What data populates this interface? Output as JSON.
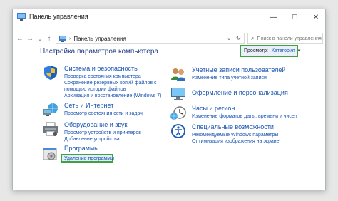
{
  "window": {
    "title": "Панель управления"
  },
  "controls": {
    "minimize": "—",
    "maximize": "☐",
    "close": "✕"
  },
  "nav": {
    "back": "←",
    "forward": "→",
    "down": "⌄",
    "up": "↑"
  },
  "address": {
    "path": "Панель управления",
    "separator": "›",
    "dropdown": "⌄",
    "refresh": "↻"
  },
  "search": {
    "placeholder": "Поиск в панели управления",
    "icon": "search-icon"
  },
  "main": {
    "heading": "Настройка параметров компьютера",
    "view_by_label": "Просмотр:",
    "view_by_value": "Категория",
    "view_by_caret": "▼"
  },
  "categories_left": [
    {
      "title": "Система и безопасность",
      "icon": "shield-icon",
      "links": [
        "Проверка состояния компьютера",
        "Сохранение резервных копий файлов с помощью истории файлов",
        "Архивация и восстановление (Windows 7)"
      ]
    },
    {
      "title": "Сеть и Интернет",
      "icon": "network-icon",
      "links": [
        "Просмотр состояния сети и задач"
      ]
    },
    {
      "title": "Оборудование и звук",
      "icon": "printer-icon",
      "links": [
        "Просмотр устройств и принтеров",
        "Добавление устройства"
      ]
    },
    {
      "title": "Программы",
      "icon": "programs-icon",
      "links": [
        "Удаление программы"
      ]
    }
  ],
  "categories_right": [
    {
      "title": "Учетные записи пользователей",
      "icon": "users-icon",
      "links": [
        "Изменение типа учетной записи"
      ]
    },
    {
      "title": "Оформление и персонализация",
      "icon": "display-icon",
      "links": []
    },
    {
      "title": "Часы и регион",
      "icon": "clock-icon",
      "links": [
        "Изменение форматов даты, времени и чисел"
      ]
    },
    {
      "title": "Специальные возможности",
      "icon": "accessibility-icon",
      "links": [
        "Рекомендуемые Windows параметры",
        "Оптимизация изображения на экране"
      ]
    }
  ],
  "colors": {
    "link": "#1a55b0",
    "heading": "#1e3c82",
    "highlight": "#3ea33e"
  }
}
